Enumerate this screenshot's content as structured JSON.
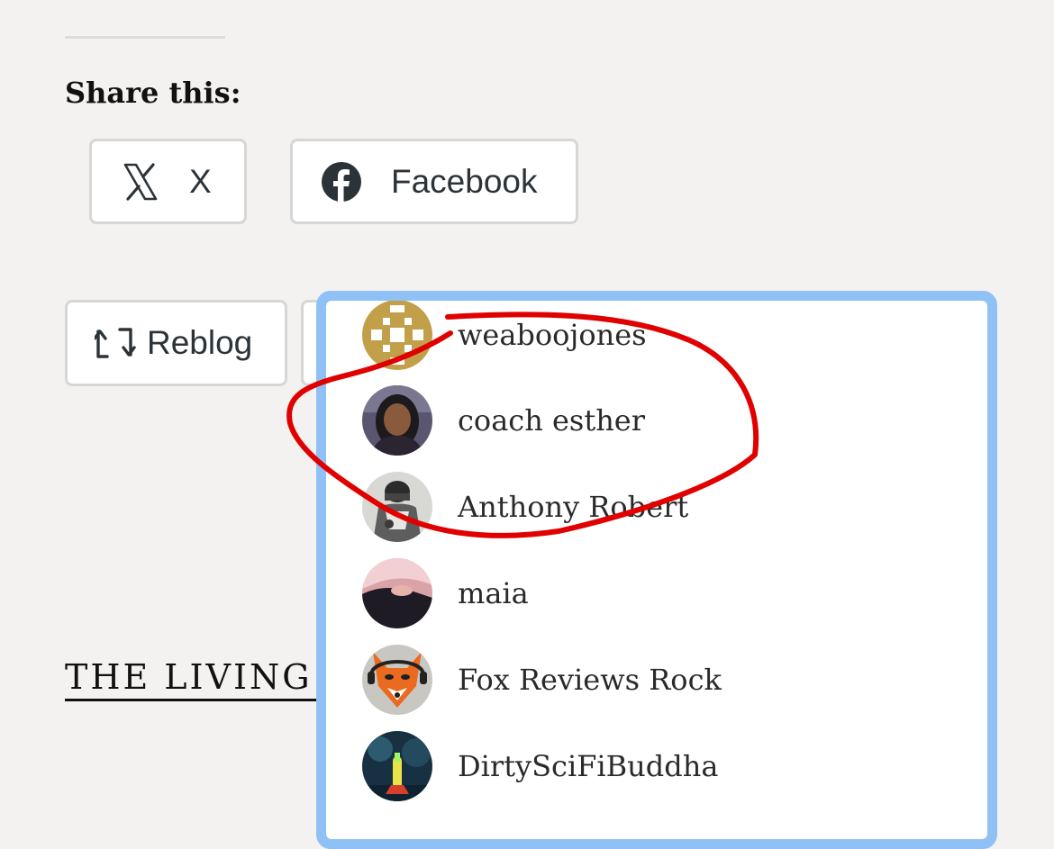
{
  "share": {
    "heading": "Share this:",
    "buttons": [
      {
        "label": "X",
        "icon": "x-logo-icon"
      },
      {
        "label": "Facebook",
        "icon": "facebook-icon"
      }
    ]
  },
  "reblog": {
    "label": "Reblog",
    "icon": "reblog-icon"
  },
  "section_title_visible": "THE LIVING D",
  "likes_popup": {
    "likers": [
      {
        "name": "weaboojones"
      },
      {
        "name": "coach esther"
      },
      {
        "name": "Anthony Robert"
      },
      {
        "name": "maia"
      },
      {
        "name": "Fox Reviews Rock"
      },
      {
        "name": "DirtySciFiBuddha"
      }
    ]
  },
  "colors": {
    "page_bg": "#f3f2f0",
    "popup_border": "#8fc1f6",
    "annotation": "#e00000"
  }
}
